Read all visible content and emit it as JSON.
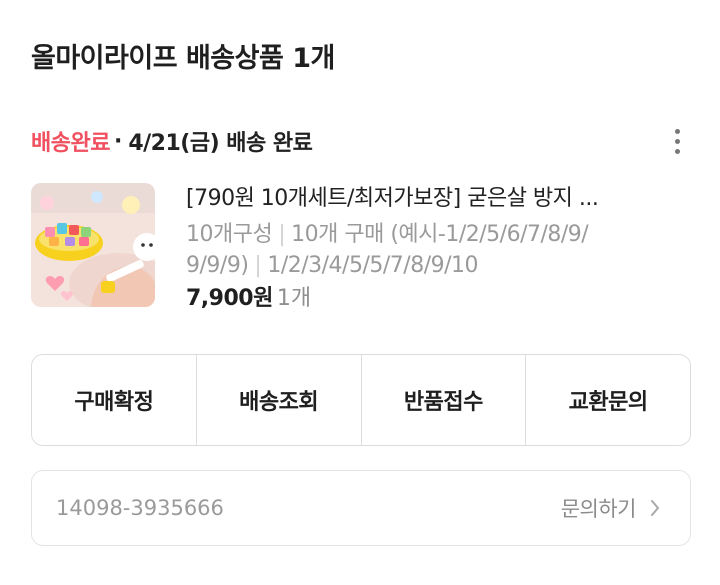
{
  "header": {
    "store_title": "올마이라이프 배송상품 1개"
  },
  "delivery": {
    "status": "배송완료",
    "separator": "·",
    "date_text": "4/21(금) 배송 완료",
    "status_color": "#f0505f"
  },
  "product": {
    "name": "[790원 10개세트/최저가보장] 굳은살 방지 ...",
    "option_count": "10개구성",
    "option_desc_line1": "10개 구매 (예시-1/2/5/6/7/8/9/",
    "option_desc_line2_a": "9/9/9)",
    "option_desc_line2_b": "1/2/3/4/5/5/7/8/9/10",
    "price": "7,900원",
    "quantity": "1개",
    "thumbnail_icon": "product-thumbnail"
  },
  "actions": {
    "confirm": "구매확정",
    "track": "배송조회",
    "return": "반품접수",
    "exchange": "교환문의"
  },
  "inquiry": {
    "order_number": "14098-3935666",
    "label": "문의하기"
  }
}
